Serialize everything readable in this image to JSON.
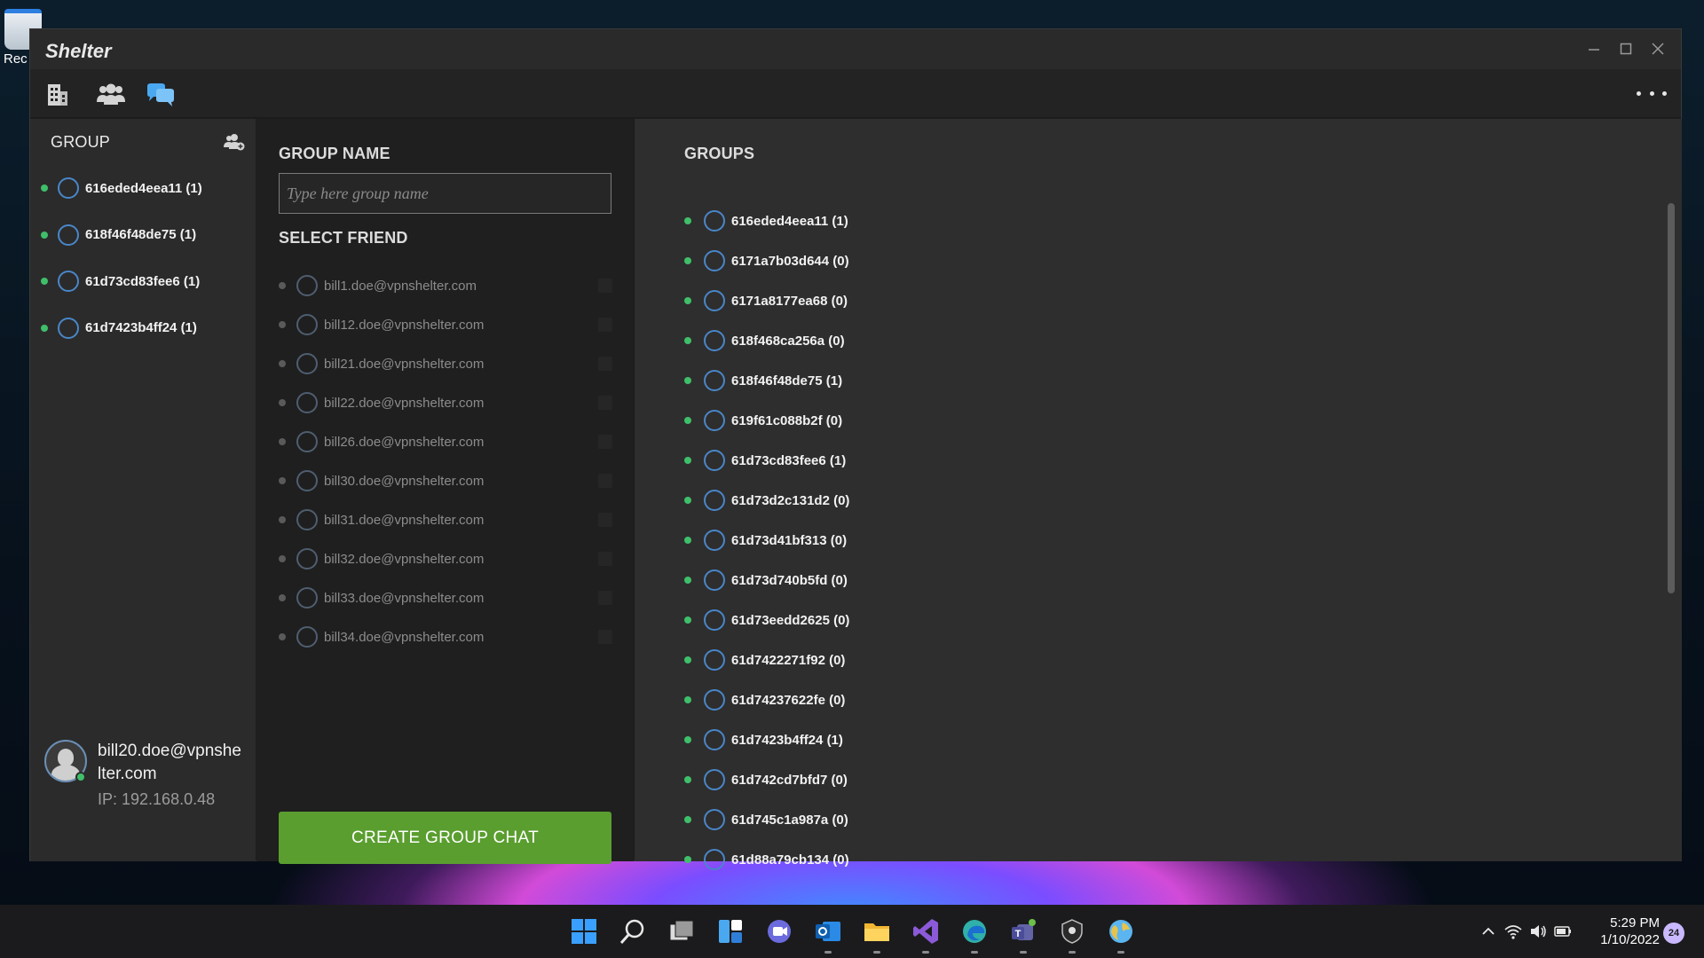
{
  "app": {
    "title": "Shelter"
  },
  "desktop": {
    "icon_label": "Rec"
  },
  "left_panel": {
    "title": "GROUP",
    "groups": [
      {
        "label": "616eded4eea11 (1)",
        "online": true
      },
      {
        "label": "618f46f48de75 (1)",
        "online": true
      },
      {
        "label": "61d73cd83fee6 (1)",
        "online": true
      },
      {
        "label": "61d7423b4ff24 (1)",
        "online": true
      }
    ],
    "user": {
      "email": "bill20.doe@vpnshelter.com",
      "ip": "IP: 192.168.0.48"
    }
  },
  "middle_panel": {
    "group_name_title": "GROUP NAME",
    "group_name_placeholder": "Type here group name",
    "select_friend_title": "SELECT FRIEND",
    "friends": [
      {
        "email": "bill1.doe@vpnshelter.com"
      },
      {
        "email": "bill12.doe@vpnshelter.com"
      },
      {
        "email": "bill21.doe@vpnshelter.com"
      },
      {
        "email": "bill22.doe@vpnshelter.com"
      },
      {
        "email": "bill26.doe@vpnshelter.com"
      },
      {
        "email": "bill30.doe@vpnshelter.com"
      },
      {
        "email": "bill31.doe@vpnshelter.com"
      },
      {
        "email": "bill32.doe@vpnshelter.com"
      },
      {
        "email": "bill33.doe@vpnshelter.com"
      },
      {
        "email": "bill34.doe@vpnshelter.com"
      }
    ],
    "create_button": "CREATE GROUP CHAT"
  },
  "right_panel": {
    "title": "GROUPS",
    "groups": [
      {
        "label": "616eded4eea11 (1)",
        "online": true
      },
      {
        "label": "6171a7b03d644 (0)",
        "online": true
      },
      {
        "label": "6171a8177ea68 (0)",
        "online": true
      },
      {
        "label": "618f468ca256a (0)",
        "online": true
      },
      {
        "label": "618f46f48de75 (1)",
        "online": true
      },
      {
        "label": "619f61c088b2f (0)",
        "online": true
      },
      {
        "label": "61d73cd83fee6 (1)",
        "online": true
      },
      {
        "label": "61d73d2c131d2 (0)",
        "online": true
      },
      {
        "label": "61d73d41bf313 (0)",
        "online": true
      },
      {
        "label": "61d73d740b5fd (0)",
        "online": true
      },
      {
        "label": "61d73eedd2625 (0)",
        "online": true
      },
      {
        "label": "61d7422271f92 (0)",
        "online": true
      },
      {
        "label": "61d74237622fe (0)",
        "online": true
      },
      {
        "label": "61d7423b4ff24 (1)",
        "online": true
      },
      {
        "label": "61d742cd7bfd7 (0)",
        "online": true
      },
      {
        "label": "61d745c1a987a (0)",
        "online": true
      },
      {
        "label": "61d88a79cb134 (0)",
        "online": true
      }
    ]
  },
  "toolbar": {
    "icons": [
      "building-icon",
      "users-icon",
      "chat-bubbles-icon"
    ]
  },
  "taskbar": {
    "time": "5:29 PM",
    "date": "1/10/2022",
    "notification_count": "24"
  },
  "colors": {
    "accent_green": "#5a9e2f",
    "online_dot": "#3fbf6a",
    "ring_blue": "#4a86c8",
    "chat_icon_blue": "#4aa8f0"
  }
}
